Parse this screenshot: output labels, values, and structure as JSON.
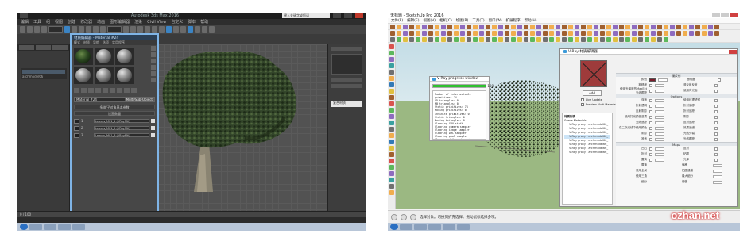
{
  "max": {
    "window_title": "Autodesk 3ds Max 2016",
    "search_placeholder": "键入关键字或短语",
    "menu": [
      "编辑",
      "工具",
      "组",
      "视图",
      "创建",
      "修改器",
      "动画",
      "图形编辑器",
      "渲染",
      "Civil View",
      "自定义",
      "脚本",
      "帮助"
    ],
    "material_editor": {
      "title": "材质编辑器 - Material #24",
      "menu": [
        "模式",
        "材质",
        "导航",
        "选项",
        "实用程序"
      ],
      "name": "Material #24",
      "type_label": "Multi/Sub-Object",
      "section_title": "多维/子对象基本参数",
      "set_number_label": "设置数量",
      "rows": [
        {
          "id": "1",
          "name": "Leaves_M01_1 (VRayMtl)"
        },
        {
          "id": "2",
          "name": "Leaves_M01_2 (VRayMtl)"
        },
        {
          "id": "3",
          "name": "Leaves_M01_3 (VRayMtl)"
        }
      ]
    },
    "scene_item": "archmodel66",
    "prop_title": "复合材质",
    "status_text": "0 / 100"
  },
  "su": {
    "window_title": "无标题 - SketchUp Pro 2016",
    "menu": [
      "文件(F)",
      "编辑(E)",
      "视图(V)",
      "相机(C)",
      "绘图(R)",
      "工具(T)",
      "窗口(W)",
      "扩展程序",
      "帮助(H)"
    ],
    "progress": {
      "title": "V-Ray progress window",
      "percent": 100,
      "percent_label": "100",
      "log": [
        "Number of intersectable primitives: 74",
        "  SD triangles: 0",
        "  MB triangles: 0",
        "  Static primitives: 74",
        "  Moving primitives: 0",
        "  Infinite primitives: 0",
        "  Static triangles: 0",
        "  Moving triangles: 0",
        "Clearing GPU stuff",
        "Clearing camera sampler",
        "Clearing image sampler",
        "Clearing DMC sampler",
        "Clearing pool sampler",
        "Clearing deferred sampler",
        "Clearing light cache engine"
      ]
    },
    "vray_editor": {
      "title": "V-Ray 材质编辑器",
      "add_button": "Add",
      "opt1": "Live Update",
      "opt2": "Preview Multi Material",
      "tree_header": "材质列表",
      "tree_root": "Scene Materials",
      "tree_items": [
        "V-Ray proxy - archmodel66_",
        "V-Ray proxy - archmodel66_",
        "V-Ray proxy - archmodel66_",
        "V-Ray proxy - archmodel66_",
        "V-Ray proxy - archmodel66_",
        "V-Ray proxy - archmodel66_",
        "V-Ray proxy - archmodel66_",
        "V-Ray proxy - archmodel66_"
      ],
      "groups": {
        "diffuse": "漫反射",
        "options": "Options",
        "maps": "Maps"
      },
      "diffuse_rows": [
        {
          "left": "颜色",
          "right": "透明度"
        },
        {
          "left": "粗糙度",
          "right": "漫反射反射"
        },
        {
          "left": "使用光泽度的MaxExt光线跟踪",
          "right": "使用背光面"
        }
      ],
      "option_rows": [
        {
          "left": "双面",
          "right": "使用纹理滤镜"
        },
        {
          "left": "折射透明",
          "right": "折射偏移"
        },
        {
          "left": "反射阴影",
          "right": "折射追踪"
        },
        {
          "left": "使用打光颜色选项",
          "right": "阴影"
        },
        {
          "left": "光线追踪",
          "right": "反射追踪"
        },
        {
          "left": "在二次光线中使用颜色",
          "right": "效果通道"
        },
        {
          "left": "阴影",
          "right": "光线分裂"
        },
        {
          "left": "其他",
          "right": "光线跟踪"
        }
      ],
      "map_rows": [
        {
          "left": "凹凸",
          "right": "反射"
        },
        {
          "left": "折射",
          "right": "贴图"
        },
        {
          "left": "置换",
          "right": "光泽"
        }
      ],
      "extra_rows": [
        "置换",
        "使用全局",
        "使用三角",
        "细分"
      ],
      "extra_right": [
        "偏移",
        "贴图通道",
        "最大细分",
        "阈值"
      ]
    },
    "status_text": "选择对象。切换到扩充选择。拖动鼠标选择多项。",
    "watermark": "ozhan.net"
  }
}
